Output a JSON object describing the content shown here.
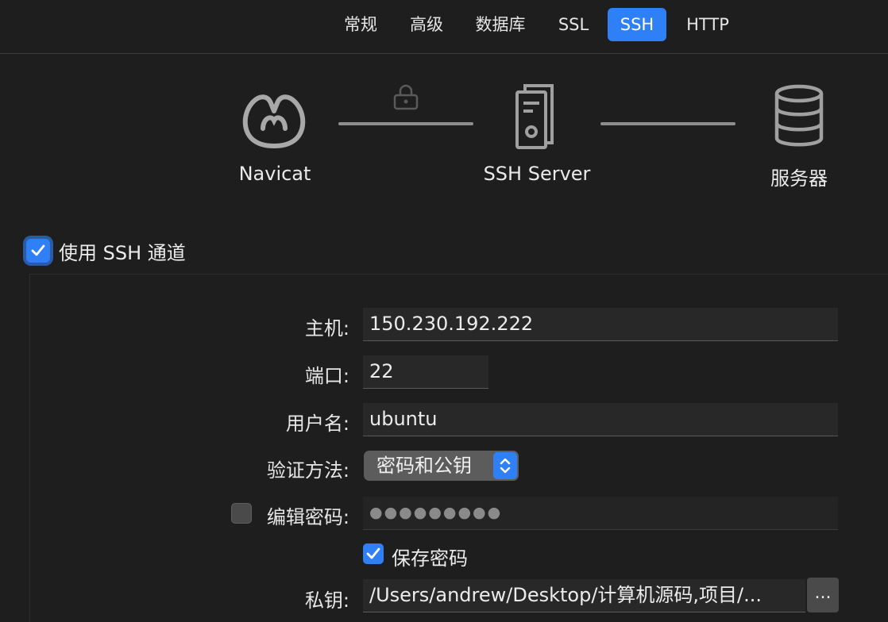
{
  "tabs": [
    {
      "label": "常规",
      "active": false
    },
    {
      "label": "高级",
      "active": false
    },
    {
      "label": "数据库",
      "active": false
    },
    {
      "label": "SSL",
      "active": false
    },
    {
      "label": "SSH",
      "active": true
    },
    {
      "label": "HTTP",
      "active": false
    }
  ],
  "diagram": {
    "client_label": "Navicat",
    "middle_label": "SSH Server",
    "target_label": "服务器",
    "client_icon": "navicat-logo-icon",
    "middle_icon": "server-icon",
    "target_icon": "database-icon",
    "lock_icon": "lock-icon"
  },
  "use_ssh": {
    "label": "使用 SSH 通道",
    "checked": true
  },
  "form": {
    "host_label": "主机:",
    "host_value": "150.230.192.222",
    "port_label": "端口:",
    "port_value": "22",
    "user_label": "用户名:",
    "user_value": "ubuntu",
    "auth_label": "验证方法:",
    "auth_value": "密码和公钥",
    "edit_pw_label": "编辑密码:",
    "edit_pw_checked": false,
    "password_value": "●●●●●●●●●",
    "save_pw_label": "保存密码",
    "save_pw_checked": true,
    "key_label": "私钥:",
    "key_value": "/Users/andrew/Desktop/计算机源码,项目/...",
    "browse_label": "..."
  },
  "colors": {
    "accent": "#2f7ff6",
    "background": "#1e1e1e"
  }
}
